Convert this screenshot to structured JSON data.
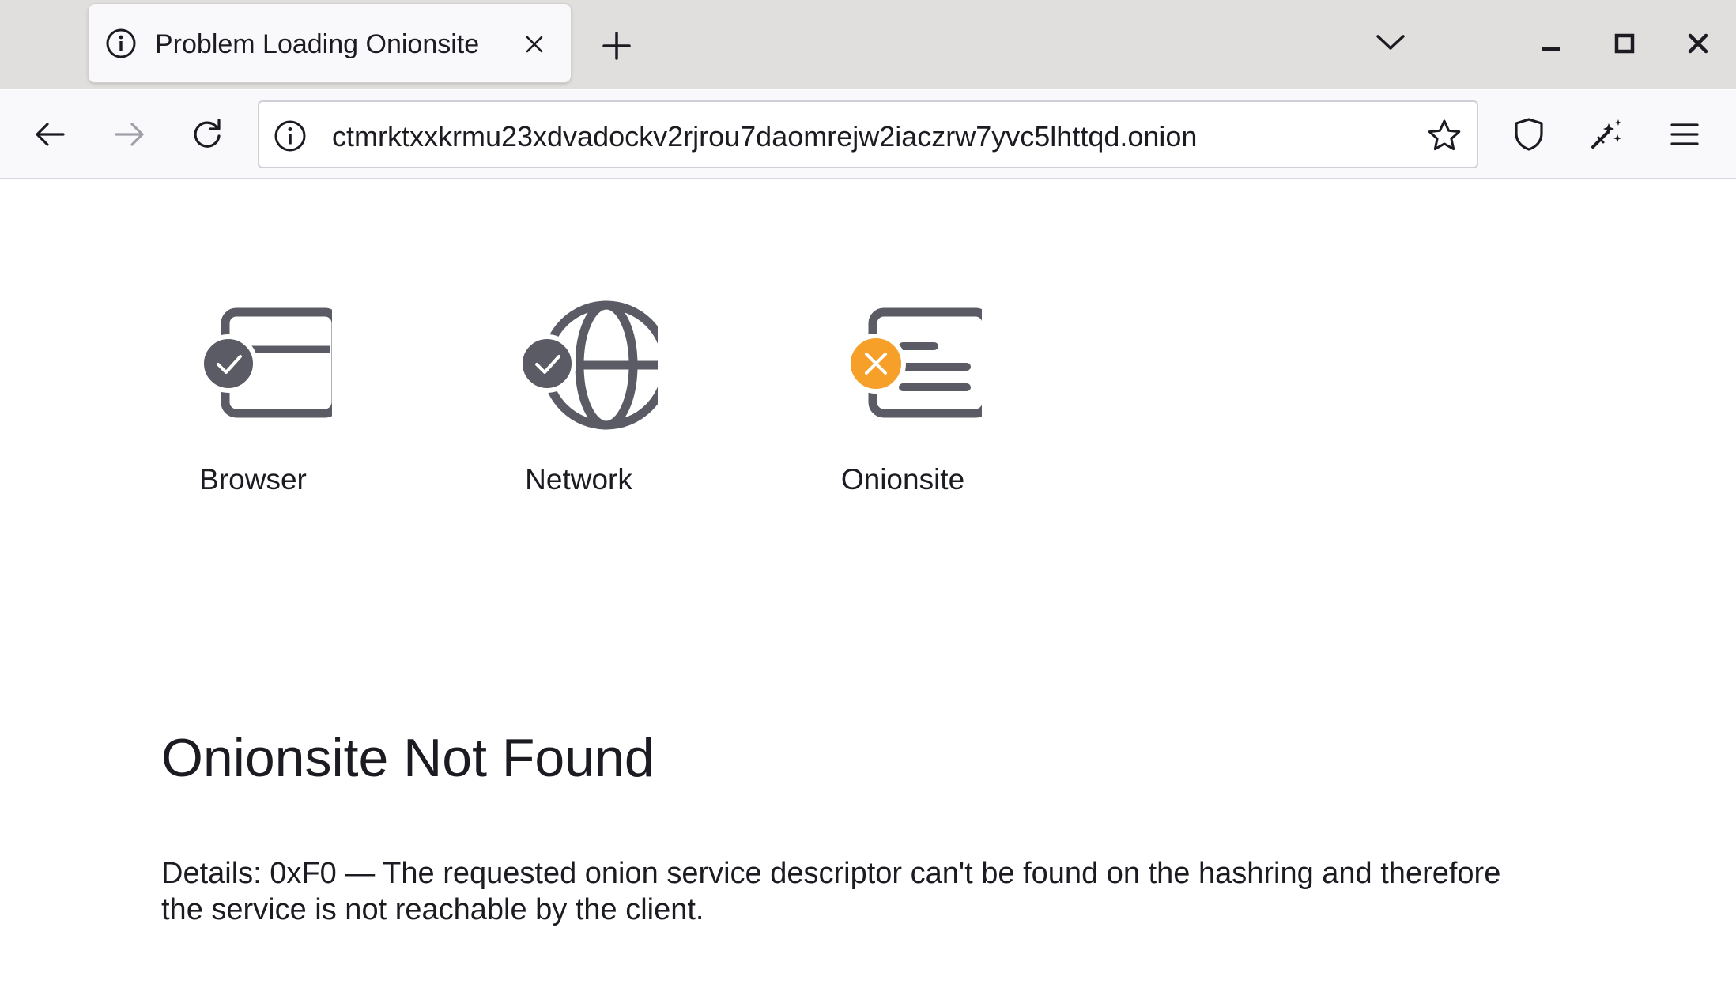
{
  "tab": {
    "title": "Problem Loading Onionsite",
    "icon": "info-icon"
  },
  "urlbar": {
    "url": "ctmrktxxkrmu23xdvadockv2rjrou7daomrejw2iaczrw7yvc5lhttqd.onion",
    "icon": "info-icon"
  },
  "toolbar": {
    "icons": [
      "back-arrow-icon",
      "forward-arrow-icon",
      "reload-icon",
      "star-icon",
      "shield-icon",
      "magic-wand-icon",
      "hamburger-menu-icon"
    ]
  },
  "window_controls": [
    "minimize-icon",
    "maximize-icon",
    "close-icon"
  ],
  "status": {
    "items": [
      {
        "label": "Browser",
        "state": "ok",
        "icon": "browser-window-icon"
      },
      {
        "label": "Network",
        "state": "ok",
        "icon": "globe-icon"
      },
      {
        "label": "Onionsite",
        "state": "error",
        "icon": "onionsite-document-icon"
      }
    ]
  },
  "error": {
    "title": "Onionsite Not Found",
    "details": "Details: 0xF0 — The requested onion service descriptor can't be found on the hashring and therefore the service is not reachable by the client."
  },
  "colors": {
    "icon_gray": "#5b5b66",
    "ok_badge": "#5b5b66",
    "error_badge": "#f6a02a",
    "tabstrip_bg": "#e1dfdd",
    "navbar_bg": "#f9f9fb"
  }
}
